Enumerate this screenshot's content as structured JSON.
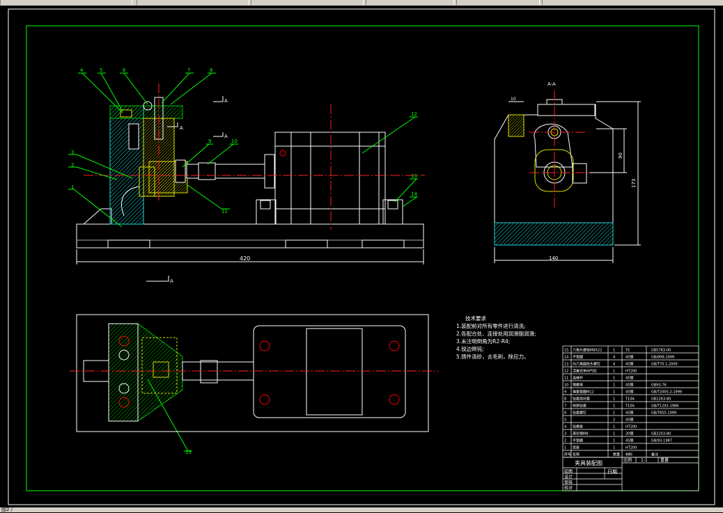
{
  "drawing": {
    "title": "夹具装配图",
    "section_label": "A-A",
    "view_marker": "A",
    "scale": "1:1",
    "scale_label": "比例",
    "weight_label": "重量",
    "sheet_label": "日期",
    "dims": {
      "overall_length": "420",
      "side_width": "140",
      "side_height": "173",
      "side_inner": "90",
      "top_width": "10"
    },
    "callouts": [
      "1",
      "2",
      "3",
      "4",
      "5",
      "6",
      "7",
      "8",
      "9",
      "10",
      "11",
      "12",
      "13",
      "14",
      "15"
    ]
  },
  "tech_requirements": {
    "heading": "技术要求",
    "items": [
      "1.装配前对所有零件进行清洗;",
      "2.各配合处、连接处用润滑脂润滑;",
      "3.未注明倒角为R2-R4;",
      "4.锐边倒钝;",
      "5.铸件清砂，去毛刺，除应力。"
    ]
  },
  "bom": {
    "rows": [
      {
        "no": "15",
        "name": "六角头螺栓M8X22",
        "qty": "1",
        "mat": "Y5",
        "std": "GB5783-00"
      },
      {
        "no": "14",
        "name": "平垫圈",
        "qty": "4",
        "mat": "45钢",
        "std": "GB/899-1999"
      },
      {
        "no": "13",
        "name": "内六角圆柱头螺钉",
        "qty": "4",
        "mat": "45钢",
        "std": "GB/T70.1-2000"
      },
      {
        "no": "12",
        "name": "活塞式单向气缸",
        "qty": "1",
        "mat": "HT200",
        "std": ""
      },
      {
        "no": "11",
        "name": "连接杆",
        "qty": "1",
        "mat": "45钢",
        "std": ""
      },
      {
        "no": "10",
        "name": "销螺母",
        "qty": "1",
        "mat": "45钢",
        "std": "GB93-76"
      },
      {
        "no": "9",
        "name": "弹簧垫圈M12",
        "qty": "1",
        "mat": "45钢",
        "std": "GB/T2005.2-1999"
      },
      {
        "no": "8",
        "name": "钻套用衬套",
        "qty": "1",
        "mat": "T10A",
        "std": "GB2263-80"
      },
      {
        "no": "7",
        "name": "快换钻套",
        "qty": "1",
        "mat": "T10A",
        "std": "GB/T1292-1986"
      },
      {
        "no": "6",
        "name": "钻套螺钉",
        "qty": "1",
        "mat": "45钢",
        "std": "GB/T855-1999"
      },
      {
        "no": "5",
        "name": "",
        "qty": "2",
        "mat": "45钢",
        "std": ""
      },
      {
        "no": "4",
        "name": "钻模板",
        "qty": "1",
        "mat": "HT200",
        "std": ""
      },
      {
        "no": "3",
        "name": "菱形销M8",
        "qty": "1",
        "mat": "20钢",
        "std": "GB2203-80"
      },
      {
        "no": "2",
        "name": "平垫圈",
        "qty": "1",
        "mat": "45钢",
        "std": "GB/93-1987"
      },
      {
        "no": "1",
        "name": "底座",
        "qty": "1",
        "mat": "HT200",
        "std": ""
      }
    ],
    "header": {
      "no": "序号",
      "name": "名称",
      "qty": "数量",
      "mat": "材料",
      "std": "备注"
    }
  },
  "title_block": {
    "rows": [
      "绘图",
      "设计",
      "审核",
      "校对"
    ],
    "date_label": "日期"
  },
  "status_text": "图2 /"
}
